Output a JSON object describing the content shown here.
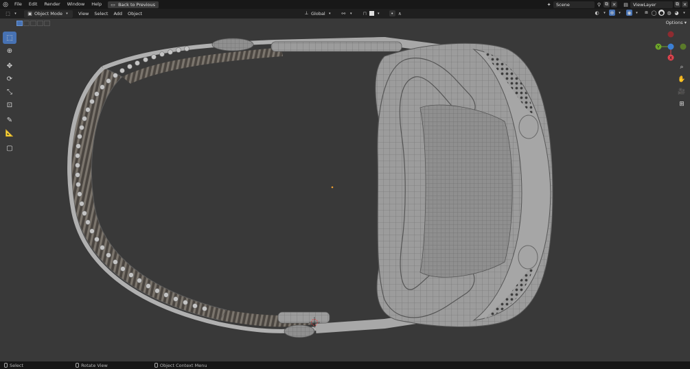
{
  "topbar": {
    "menus": [
      "File",
      "Edit",
      "Render",
      "Window",
      "Help"
    ],
    "back_button": "Back to Previous",
    "scene_label": "Scene",
    "view_layer_label": "ViewLayer"
  },
  "viewport_header": {
    "mode": "Object Mode",
    "menus": [
      "View",
      "Select",
      "Add",
      "Object"
    ],
    "transform_orientation": "Global",
    "options_label": "Options"
  },
  "gizmo": {
    "axes": {
      "x_color": "#e0444e",
      "y_color": "#6fa82b",
      "z_color": "#3b7fd4"
    }
  },
  "statusbar": {
    "items": [
      "Select",
      "Rotate View",
      "Object Context Menu"
    ]
  },
  "colors": {
    "accent": "#4772b3",
    "viewport_bg": "#393939",
    "mesh": "#9a9a9a"
  },
  "icons": {
    "toolbar": [
      "select-box-icon",
      "cursor-icon",
      "move-icon",
      "rotate-icon",
      "scale-icon",
      "transform-icon",
      "annotate-icon",
      "measure-icon",
      "add-cube-icon"
    ],
    "nav": [
      "zoom-icon",
      "pan-hand-icon",
      "camera-icon",
      "grid-icon"
    ]
  }
}
